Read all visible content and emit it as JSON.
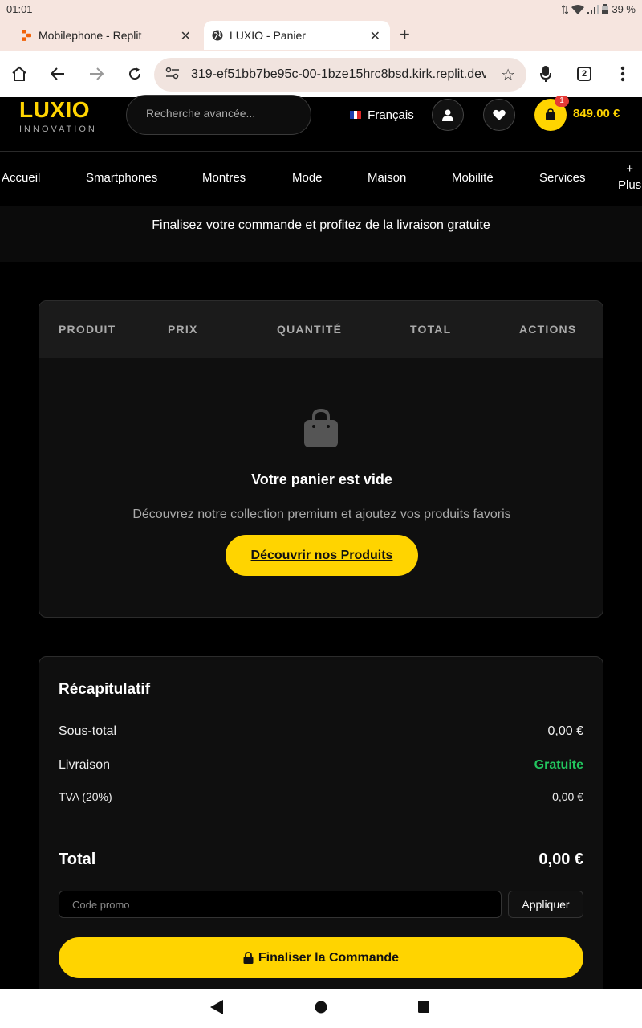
{
  "status_bar": {
    "time": "01:01",
    "battery": "39 %"
  },
  "browser": {
    "tabs": [
      {
        "title": "Mobilephone - Replit",
        "favicon": "replit-icon"
      },
      {
        "title": "LUXIO - Panier",
        "favicon": "globe-icon",
        "active": true
      }
    ],
    "url": "319-ef51bb7be95c-00-1bze15hrc8bsd.kirk.replit.dev",
    "tab_count": "2"
  },
  "header": {
    "logo": "LUXIO",
    "logo_sub": "INNOVATION",
    "search_placeholder": "Recherche avancée...",
    "language": "Français",
    "cart_badge": "1",
    "cart_total": "849.00 €"
  },
  "nav": {
    "items": [
      "Accueil",
      "Smartphones",
      "Montres",
      "Mode",
      "Maison",
      "Mobilité",
      "Services"
    ],
    "more_plus": "+",
    "more_label": "Plus"
  },
  "banner": {
    "text": "Finalisez votre commande et profitez de la livraison gratuite"
  },
  "cart": {
    "columns": [
      "PRODUIT",
      "PRIX",
      "QUANTITÉ",
      "TOTAL",
      "ACTIONS"
    ],
    "empty_title": "Votre panier est vide",
    "empty_subtitle": "Découvrez notre collection premium et ajoutez vos produits favoris",
    "discover_button": "Découvrir nos Produits"
  },
  "summary": {
    "title": "Récapitulatif",
    "subtotal_label": "Sous-total",
    "subtotal_value": "0,00 €",
    "shipping_label": "Livraison",
    "shipping_value": "Gratuite",
    "tax_label": "TVA (20%)",
    "tax_value": "0,00 €",
    "total_label": "Total",
    "total_value": "0,00 €",
    "promo_placeholder": "Code promo",
    "apply_button": "Appliquer",
    "checkout_button": "Finaliser la Commande"
  },
  "colors": {
    "accent": "#ffd400",
    "success": "#22c55e",
    "badge": "#e53935"
  }
}
